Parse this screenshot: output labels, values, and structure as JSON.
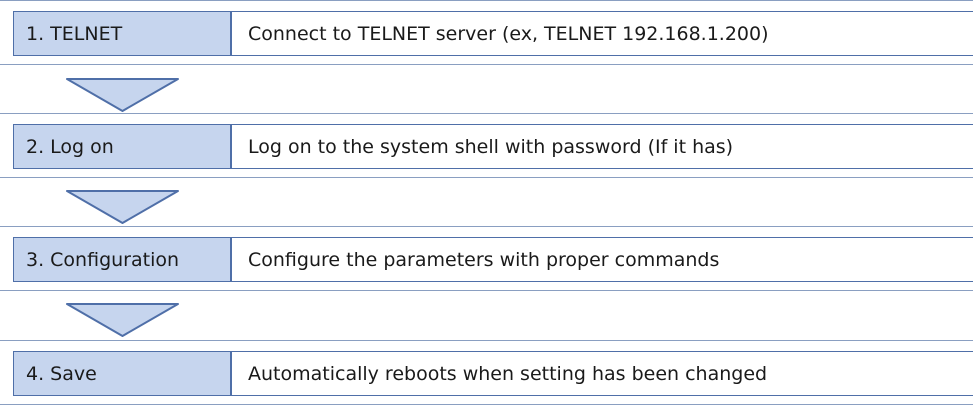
{
  "steps": [
    {
      "label": "1. TELNET",
      "description": "Connect to TELNET server (ex, TELNET 192.168.1.200)"
    },
    {
      "label": "2. Log on",
      "description": "Log on to the system shell with password (If it has)"
    },
    {
      "label": "3. Configuration",
      "description": "Configure the parameters with proper commands"
    },
    {
      "label": "4. Save",
      "description": "Automatically reboots when setting has been changed"
    }
  ],
  "colors": {
    "label_fill": "#c6d5ee",
    "border": "#4f6fa8",
    "arrow_fill": "#c6d5ee",
    "arrow_stroke": "#4f6fa8"
  }
}
